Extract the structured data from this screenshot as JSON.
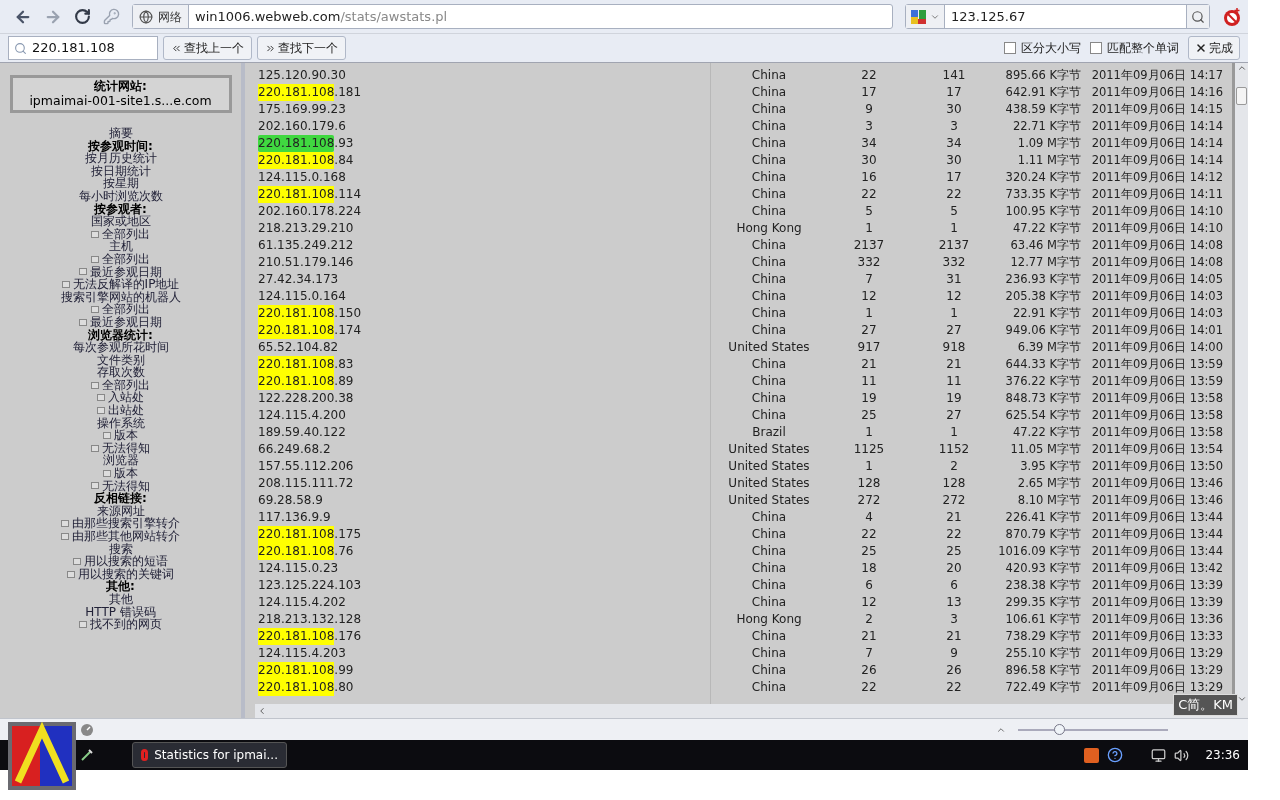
{
  "toolbar": {
    "zone_label": "网络",
    "url_host": "win1006.webweb.com",
    "url_path": "/stats/awstats.pl",
    "search_value": "123.125.67"
  },
  "find_bar": {
    "value": "220.181.108",
    "prev": "查找上一个",
    "next": "查找下一个",
    "options": [
      {
        "label": "区分大小写",
        "checked": false
      },
      {
        "label": "匹配整个单词",
        "checked": false
      }
    ],
    "done": "完成"
  },
  "sidebar": {
    "site_title": "统计网站:",
    "site_name": "ipmaimai-001-site1.s...e.com",
    "items": [
      {
        "kind": "link",
        "label": "摘要"
      },
      {
        "kind": "heading",
        "label": "按参观时间:"
      },
      {
        "kind": "link",
        "label": "按月历史统计"
      },
      {
        "kind": "link",
        "label": "按日期统计"
      },
      {
        "kind": "link",
        "label": "按星期"
      },
      {
        "kind": "link",
        "label": "每小时浏览次数"
      },
      {
        "kind": "heading",
        "label": "按参观者:"
      },
      {
        "kind": "link",
        "label": "国家或地区"
      },
      {
        "kind": "sub",
        "label": "全部列出"
      },
      {
        "kind": "link",
        "label": "主机"
      },
      {
        "kind": "sub",
        "label": "全部列出"
      },
      {
        "kind": "sub",
        "label": "最近参观日期"
      },
      {
        "kind": "sub",
        "label": "无法反解译的IP地址"
      },
      {
        "kind": "link",
        "label": "搜索引擎网站的机器人"
      },
      {
        "kind": "sub",
        "label": "全部列出"
      },
      {
        "kind": "sub",
        "label": "最近参观日期"
      },
      {
        "kind": "heading",
        "label": "浏览器统计:"
      },
      {
        "kind": "link",
        "label": "每次参观所花时间"
      },
      {
        "kind": "link",
        "label": "文件类别"
      },
      {
        "kind": "link",
        "label": "存取次数"
      },
      {
        "kind": "sub",
        "label": "全部列出"
      },
      {
        "kind": "sub",
        "label": "入站处"
      },
      {
        "kind": "sub",
        "label": "出站处"
      },
      {
        "kind": "link",
        "label": "操作系统"
      },
      {
        "kind": "sub",
        "label": "版本"
      },
      {
        "kind": "sub",
        "label": "无法得知"
      },
      {
        "kind": "link",
        "label": "浏览器"
      },
      {
        "kind": "sub",
        "label": "版本"
      },
      {
        "kind": "sub",
        "label": "无法得知"
      },
      {
        "kind": "heading",
        "label": "反相链接:"
      },
      {
        "kind": "link",
        "label": "来源网址"
      },
      {
        "kind": "sub",
        "label": "由那些搜索引擎转介"
      },
      {
        "kind": "sub",
        "label": "由那些其他网站转介"
      },
      {
        "kind": "link",
        "label": "搜索"
      },
      {
        "kind": "sub",
        "label": "用以搜索的短语"
      },
      {
        "kind": "sub",
        "label": "用以搜索的关键词"
      },
      {
        "kind": "heading",
        "label": "其他:"
      },
      {
        "kind": "link",
        "label": "其他"
      },
      {
        "kind": "link",
        "label": "HTTP 错误码"
      },
      {
        "kind": "sub",
        "label": "找不到的网页"
      }
    ]
  },
  "table": {
    "rows": [
      {
        "kind": "plain",
        "host": "125.120.90.30",
        "country": "China",
        "pages": "22",
        "hits": "141",
        "bandwidth": "895.66 K字节",
        "last_visit": "2011年09月06日 14:17"
      },
      {
        "kind": "match",
        "host": "220.181.108",
        "host_rest": ".181",
        "country": "China",
        "pages": "17",
        "hits": "17",
        "bandwidth": "642.91 K字节",
        "last_visit": "2011年09月06日 14:16"
      },
      {
        "kind": "plain",
        "host": "175.169.99.23",
        "country": "China",
        "pages": "9",
        "hits": "30",
        "bandwidth": "438.59 K字节",
        "last_visit": "2011年09月06日 14:15"
      },
      {
        "kind": "plain",
        "host": "202.160.179.6",
        "country": "China",
        "pages": "3",
        "hits": "3",
        "bandwidth": "22.71 K字节",
        "last_visit": "2011年09月06日 14:14"
      },
      {
        "kind": "current",
        "host": "220.181.108",
        "host_rest": ".93",
        "country": "China",
        "pages": "34",
        "hits": "34",
        "bandwidth": "1.09 M字节",
        "last_visit": "2011年09月06日 14:14"
      },
      {
        "kind": "match",
        "host": "220.181.108",
        "host_rest": ".84",
        "country": "China",
        "pages": "30",
        "hits": "30",
        "bandwidth": "1.11 M字节",
        "last_visit": "2011年09月06日 14:14"
      },
      {
        "kind": "plain",
        "host": "124.115.0.168",
        "country": "China",
        "pages": "16",
        "hits": "17",
        "bandwidth": "320.24 K字节",
        "last_visit": "2011年09月06日 14:12"
      },
      {
        "kind": "match",
        "host": "220.181.108",
        "host_rest": ".114",
        "country": "China",
        "pages": "22",
        "hits": "22",
        "bandwidth": "733.35 K字节",
        "last_visit": "2011年09月06日 14:11"
      },
      {
        "kind": "plain",
        "host": "202.160.178.224",
        "country": "China",
        "pages": "5",
        "hits": "5",
        "bandwidth": "100.95 K字节",
        "last_visit": "2011年09月06日 14:10"
      },
      {
        "kind": "plain",
        "host": "218.213.29.210",
        "country": "Hong Kong",
        "pages": "1",
        "hits": "1",
        "bandwidth": "47.22 K字节",
        "last_visit": "2011年09月06日 14:10"
      },
      {
        "kind": "plain",
        "host": "61.135.249.212",
        "country": "China",
        "pages": "2137",
        "hits": "2137",
        "bandwidth": "63.46 M字节",
        "last_visit": "2011年09月06日 14:08"
      },
      {
        "kind": "plain",
        "host": "210.51.179.146",
        "country": "China",
        "pages": "332",
        "hits": "332",
        "bandwidth": "12.77 M字节",
        "last_visit": "2011年09月06日 14:08"
      },
      {
        "kind": "plain",
        "host": "27.42.34.173",
        "country": "China",
        "pages": "7",
        "hits": "31",
        "bandwidth": "236.93 K字节",
        "last_visit": "2011年09月06日 14:05"
      },
      {
        "kind": "plain",
        "host": "124.115.0.164",
        "country": "China",
        "pages": "12",
        "hits": "12",
        "bandwidth": "205.38 K字节",
        "last_visit": "2011年09月06日 14:03"
      },
      {
        "kind": "match",
        "host": "220.181.108",
        "host_rest": ".150",
        "country": "China",
        "pages": "1",
        "hits": "1",
        "bandwidth": "22.91 K字节",
        "last_visit": "2011年09月06日 14:03"
      },
      {
        "kind": "match",
        "host": "220.181.108",
        "host_rest": ".174",
        "country": "China",
        "pages": "27",
        "hits": "27",
        "bandwidth": "949.06 K字节",
        "last_visit": "2011年09月06日 14:01"
      },
      {
        "kind": "plain",
        "host": "65.52.104.82",
        "country": "United States",
        "pages": "917",
        "hits": "918",
        "bandwidth": "6.39 M字节",
        "last_visit": "2011年09月06日 14:00"
      },
      {
        "kind": "match",
        "host": "220.181.108",
        "host_rest": ".83",
        "country": "China",
        "pages": "21",
        "hits": "21",
        "bandwidth": "644.33 K字节",
        "last_visit": "2011年09月06日 13:59"
      },
      {
        "kind": "match",
        "host": "220.181.108",
        "host_rest": ".89",
        "country": "China",
        "pages": "11",
        "hits": "11",
        "bandwidth": "376.22 K字节",
        "last_visit": "2011年09月06日 13:59"
      },
      {
        "kind": "plain",
        "host": "122.228.200.38",
        "country": "China",
        "pages": "19",
        "hits": "19",
        "bandwidth": "848.73 K字节",
        "last_visit": "2011年09月06日 13:58"
      },
      {
        "kind": "plain",
        "host": "124.115.4.200",
        "country": "China",
        "pages": "25",
        "hits": "27",
        "bandwidth": "625.54 K字节",
        "last_visit": "2011年09月06日 13:58"
      },
      {
        "kind": "plain",
        "host": "189.59.40.122",
        "country": "Brazil",
        "pages": "1",
        "hits": "1",
        "bandwidth": "47.22 K字节",
        "last_visit": "2011年09月06日 13:58"
      },
      {
        "kind": "plain",
        "host": "66.249.68.2",
        "country": "United States",
        "pages": "1125",
        "hits": "1152",
        "bandwidth": "11.05 M字节",
        "last_visit": "2011年09月06日 13:54"
      },
      {
        "kind": "plain",
        "host": "157.55.112.206",
        "country": "United States",
        "pages": "1",
        "hits": "2",
        "bandwidth": "3.95 K字节",
        "last_visit": "2011年09月06日 13:50"
      },
      {
        "kind": "plain",
        "host": "208.115.111.72",
        "country": "United States",
        "pages": "128",
        "hits": "128",
        "bandwidth": "2.65 M字节",
        "last_visit": "2011年09月06日 13:46"
      },
      {
        "kind": "plain",
        "host": "69.28.58.9",
        "country": "United States",
        "pages": "272",
        "hits": "272",
        "bandwidth": "8.10 M字节",
        "last_visit": "2011年09月06日 13:46"
      },
      {
        "kind": "plain",
        "host": "117.136.9.9",
        "country": "China",
        "pages": "4",
        "hits": "21",
        "bandwidth": "226.41 K字节",
        "last_visit": "2011年09月06日 13:44"
      },
      {
        "kind": "match",
        "host": "220.181.108",
        "host_rest": ".175",
        "country": "China",
        "pages": "22",
        "hits": "22",
        "bandwidth": "870.79 K字节",
        "last_visit": "2011年09月06日 13:44"
      },
      {
        "kind": "match",
        "host": "220.181.108",
        "host_rest": ".76",
        "country": "China",
        "pages": "25",
        "hits": "25",
        "bandwidth": "1016.09 K字节",
        "last_visit": "2011年09月06日 13:44"
      },
      {
        "kind": "plain",
        "host": "124.115.0.23",
        "country": "China",
        "pages": "18",
        "hits": "20",
        "bandwidth": "420.93 K字节",
        "last_visit": "2011年09月06日 13:42"
      },
      {
        "kind": "plain",
        "host": "123.125.224.103",
        "country": "China",
        "pages": "6",
        "hits": "6",
        "bandwidth": "238.38 K字节",
        "last_visit": "2011年09月06日 13:39"
      },
      {
        "kind": "plain",
        "host": "124.115.4.202",
        "country": "China",
        "pages": "12",
        "hits": "13",
        "bandwidth": "299.35 K字节",
        "last_visit": "2011年09月06日 13:39"
      },
      {
        "kind": "plain",
        "host": "218.213.132.128",
        "country": "Hong Kong",
        "pages": "2",
        "hits": "3",
        "bandwidth": "106.61 K字节",
        "last_visit": "2011年09月06日 13:36"
      },
      {
        "kind": "match",
        "host": "220.181.108",
        "host_rest": ".176",
        "country": "China",
        "pages": "21",
        "hits": "21",
        "bandwidth": "738.29 K字节",
        "last_visit": "2011年09月06日 13:33"
      },
      {
        "kind": "plain",
        "host": "124.115.4.203",
        "country": "China",
        "pages": "7",
        "hits": "9",
        "bandwidth": "255.10 K字节",
        "last_visit": "2011年09月06日 13:29"
      },
      {
        "kind": "match",
        "host": "220.181.108",
        "host_rest": ".99",
        "country": "China",
        "pages": "26",
        "hits": "26",
        "bandwidth": "896.58 K字节",
        "last_visit": "2011年09月06日 13:29"
      },
      {
        "kind": "match",
        "host": "220.181.108",
        "host_rest": ".80",
        "country": "China",
        "pages": "22",
        "hits": "22",
        "bandwidth": "722.49 K字节",
        "last_visit": "2011年09月06日 13:29"
      }
    ]
  },
  "ime_bar": "C简。KM",
  "zoom_slider": {
    "level": 0.27
  },
  "taskbar": {
    "window_button": "Statistics for ipmai...",
    "clock": "23:36"
  }
}
